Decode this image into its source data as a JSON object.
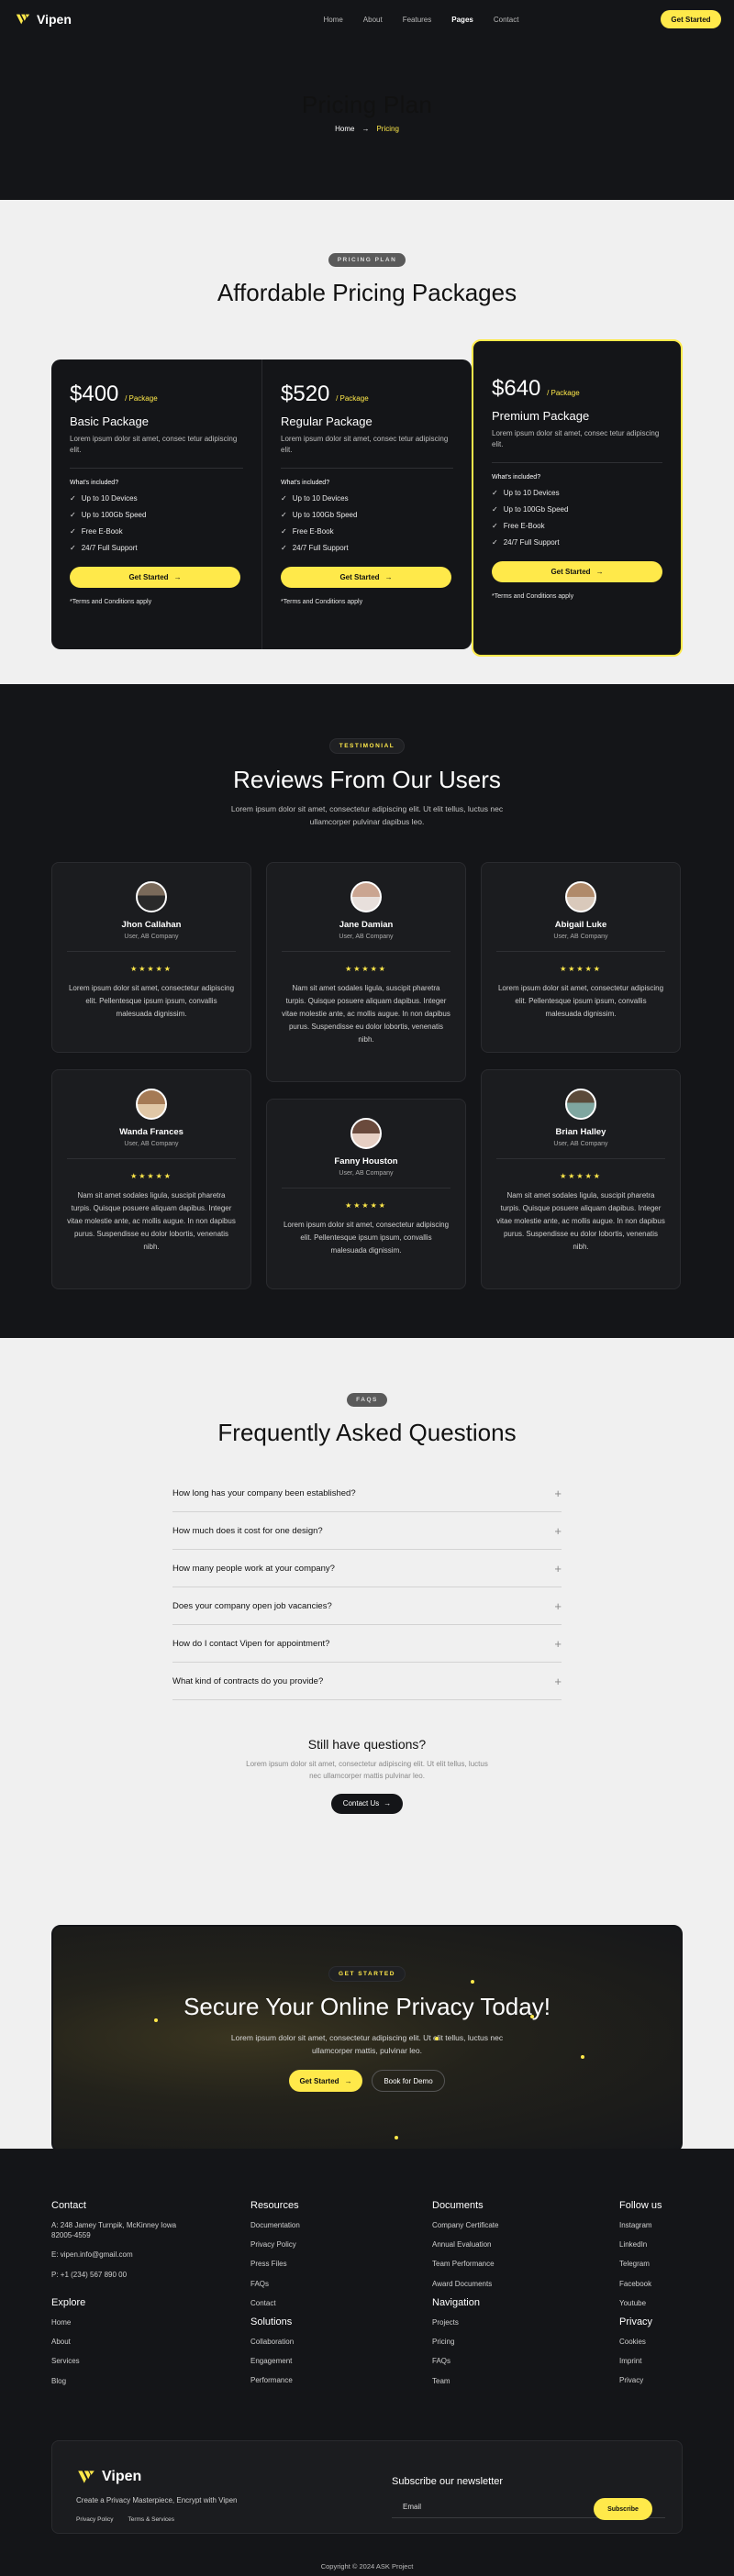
{
  "nav": {
    "brand": "Vipen",
    "links": [
      "Home",
      "About",
      "Features",
      "Pages",
      "Contact"
    ],
    "active": "Pages",
    "cta": "Get Started"
  },
  "hero": {
    "title": "Pricing Plan",
    "crumb_home": "Home",
    "crumb_sep": "→",
    "crumb_current": "Pricing"
  },
  "pricing": {
    "badge": "PRICING PLAN",
    "title": "Affordable Pricing Packages",
    "included_label": "What's included?",
    "button": "Get Started",
    "terms": "*Terms and Conditions apply",
    "plans": [
      {
        "price": "$400",
        "unit": "/ Package",
        "name": "Basic Package",
        "desc": "Lorem ipsum dolor sit amet, consec tetur adipiscing elit.",
        "features": [
          "Up to 10 Devices",
          "Up to 100Gb Speed",
          "Free E-Book",
          "24/7 Full Support"
        ]
      },
      {
        "price": "$520",
        "unit": "/ Package",
        "name": "Regular Package",
        "desc": "Lorem ipsum dolor sit amet, consec tetur adipiscing elit.",
        "features": [
          "Up to 10 Devices",
          "Up to 100Gb Speed",
          "Free E-Book",
          "24/7 Full Support"
        ]
      },
      {
        "price": "$640",
        "unit": "/ Package",
        "name": "Premium Package",
        "desc": "Lorem ipsum dolor sit amet, consec tetur adipiscing elit.",
        "features": [
          "Up to 10 Devices",
          "Up to 100Gb Speed",
          "Free E-Book",
          "24/7 Full Support"
        ]
      }
    ]
  },
  "reviews": {
    "badge": "TESTIMONIAL",
    "title": "Reviews From Our Users",
    "subtitle": "Lorem ipsum dolor sit amet, consectetur adipiscing elit. Ut elit tellus, luctus nec ullamcorper pulvinar dapibus leo.",
    "stars": "★★★★★",
    "items": [
      {
        "name": "Jhon Callahan",
        "role": "User, AB Company",
        "text": "Lorem ipsum dolor sit amet, consectetur adipiscing elit. Pellentesque ipsum ipsum, convallis malesuada dignissim."
      },
      {
        "name": "Jane Damian",
        "role": "User, AB Company",
        "text": "Nam sit amet sodales ligula, suscipit pharetra turpis. Quisque posuere aliquam dapibus. Integer vitae molestie ante, ac mollis augue. In non dapibus purus. Suspendisse eu dolor lobortis, venenatis nibh."
      },
      {
        "name": "Abigail Luke",
        "role": "User, AB Company",
        "text": "Lorem ipsum dolor sit amet, consectetur adipiscing elit. Pellentesque ipsum ipsum, convallis malesuada dignissim."
      },
      {
        "name": "Wanda Frances",
        "role": "User, AB Company",
        "text": "Nam sit amet sodales ligula, suscipit pharetra turpis. Quisque posuere aliquam dapibus. Integer vitae molestie ante, ac mollis augue. In non dapibus purus. Suspendisse eu dolor lobortis, venenatis nibh."
      },
      {
        "name": "Fanny Houston",
        "role": "User, AB Company",
        "text": "Lorem ipsum dolor sit amet, consectetur adipiscing elit. Pellentesque ipsum ipsum, convallis malesuada dignissim."
      },
      {
        "name": "Brian Halley",
        "role": "User, AB Company",
        "text": "Nam sit amet sodales ligula, suscipit pharetra turpis. Quisque posuere aliquam dapibus. Integer vitae molestie ante, ac mollis augue. In non dapibus purus. Suspendisse eu dolor lobortis, venenatis nibh."
      }
    ]
  },
  "faq": {
    "badge": "FAQS",
    "title": "Frequently Asked Questions",
    "questions": [
      "How long has your company been established?",
      "How much does it cost for one design?",
      "How many people work at your company?",
      "Does your company open job vacancies?",
      "How do I contact Vipen for appointment?",
      "What kind of contracts do you provide?"
    ],
    "still_title": "Still have questions?",
    "still_text": "Lorem ipsum dolor sit amet, consectetur adipiscing elit. Ut elit tellus, luctus nec ullamcorper mattis pulvinar leo.",
    "contact_button": "Contact Us"
  },
  "cta": {
    "badge": "GET STARTED",
    "title": "Secure Your Online Privacy Today!",
    "text": "Lorem ipsum dolor sit amet, consectetur adipiscing elit. Ut elit tellus, luctus nec ullamcorper mattis, pulvinar leo.",
    "primary": "Get Started",
    "secondary": "Book for Demo"
  },
  "footer": {
    "contact": {
      "title": "Contact",
      "address": "A: 248 Jamey Turnpik, McKinney Iowa 82005-4559",
      "email": "E: vipen.info@gmail.com",
      "phone": "P: +1 (234) 567 890 00"
    },
    "explore": {
      "title": "Explore",
      "links": [
        "Home",
        "About",
        "Services",
        "Blog"
      ]
    },
    "resources": {
      "title": "Resources",
      "links": [
        "Documentation",
        "Privacy Policy",
        "Press Files",
        "FAQs",
        "Contact"
      ]
    },
    "solutions": {
      "title": "Solutions",
      "links": [
        "Collaboration",
        "Engagement",
        "Performance"
      ]
    },
    "documents": {
      "title": "Documents",
      "links": [
        "Company Certificate",
        "Annual Evaluation",
        "Team Performance",
        "Award Documents"
      ]
    },
    "navigation": {
      "title": "Navigation",
      "links": [
        "Projects",
        "Pricing",
        "FAQs",
        "Team"
      ]
    },
    "follow": {
      "title": "Follow us",
      "links": [
        "Instagram",
        "LinkedIn",
        "Telegram",
        "Facebook",
        "Youtube"
      ]
    },
    "privacy": {
      "title": "Privacy",
      "links": [
        "Cookies",
        "Imprint",
        "Privacy"
      ]
    },
    "brand": "Vipen",
    "tagline": "Create a Privacy Masterpiece, Encrypt with Vipen",
    "legal": [
      "Privacy Policy",
      "Terms & Services"
    ],
    "newsletter_title": "Subscribe our newsletter",
    "newsletter_placeholder": "Email",
    "subscribe": "Subscribe",
    "copyright": "Copyright © 2024 ASK Project"
  },
  "colors": {
    "accent": "#ffe94a",
    "dark": "#141518",
    "light": "#f0f0f0"
  }
}
